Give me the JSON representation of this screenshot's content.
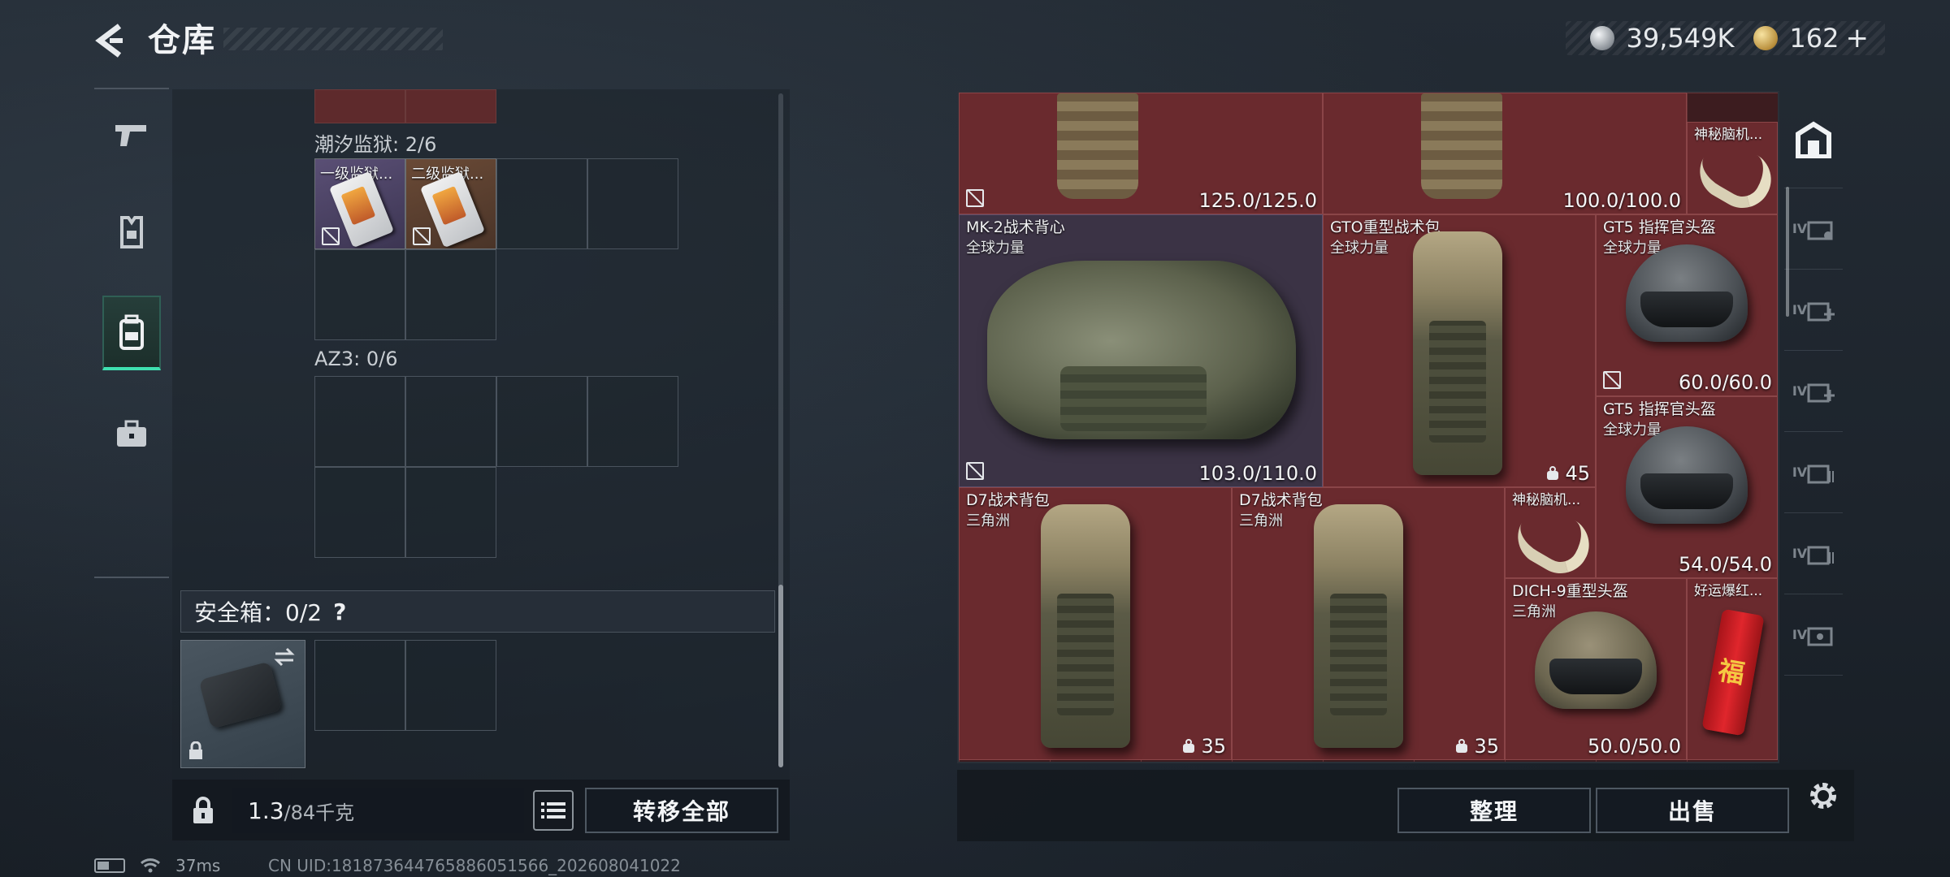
{
  "header": {
    "title": "仓库",
    "currency_silver": "39,549K",
    "currency_gold": "162",
    "plus_label": "+"
  },
  "rail": {
    "items": [
      "weapon-icon",
      "armor-icon",
      "backpack-icon",
      "briefcase-icon"
    ],
    "active_index": 2
  },
  "left_panel": {
    "sections": [
      {
        "label": "潮汐监狱: 2/6",
        "items": [
          "一级监狱...",
          "二级监狱..."
        ]
      },
      {
        "label": "AZ3: 0/6"
      }
    ],
    "safe_box_label": "安全箱：0/2",
    "help_label": "?",
    "weight_value": "1.3",
    "weight_capacity": "/84千克",
    "transfer_all_label": "转移全部"
  },
  "stash": {
    "items": [
      {
        "durability": "125.0/125.0"
      },
      {
        "durability": "100.0/100.0"
      },
      {
        "name": "神秘脑机..."
      },
      {
        "name": "MK-2战术背心",
        "sub": "全球力量",
        "durability": "103.0/110.0"
      },
      {
        "name": "GTO重型战术包",
        "sub": "全球力量",
        "capacity": "45"
      },
      {
        "name": "GT5 指挥官头盔",
        "sub": "全球力量",
        "durability": "60.0/60.0"
      },
      {
        "name": "GT5 指挥官头盔",
        "sub": "全球力量",
        "durability": "54.0/54.0"
      },
      {
        "name": "D7战术背包",
        "sub": "三角洲",
        "capacity": "35"
      },
      {
        "name": "D7战术背包",
        "sub": "三角洲",
        "capacity": "35"
      },
      {
        "name": "神秘脑机..."
      },
      {
        "name": "DICH-9重型头盔",
        "sub": "三角洲",
        "durability": "50.0/50.0"
      },
      {
        "name": "好运爆红..."
      }
    ],
    "sort_label": "整理",
    "sell_label": "出售",
    "right_tabs": [
      "home-icon",
      "IV",
      "IV",
      "IV",
      "IV",
      "IV",
      "IV"
    ]
  },
  "status_bar": {
    "ping": "37ms",
    "uid": "CN UID:18187364476588605156​6_202608041022"
  }
}
